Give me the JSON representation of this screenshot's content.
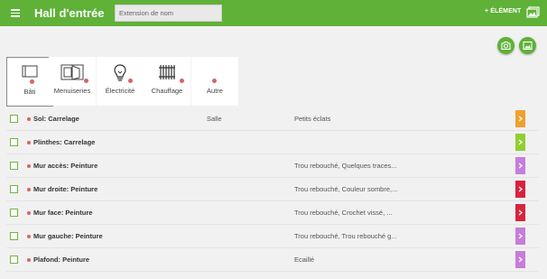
{
  "header": {
    "title": "Hall d'entrée",
    "search_placeholder": "Extension de nom",
    "add_label": "+ ÉLÉMENT"
  },
  "tabs": [
    {
      "label": "Bâti",
      "icon": "wall-icon",
      "active": true
    },
    {
      "label": "Menuiseries",
      "icon": "window-icon",
      "active": false
    },
    {
      "label": "Électricité",
      "icon": "lightbulb-icon",
      "active": false
    },
    {
      "label": "Chauffage",
      "icon": "radiator-icon",
      "active": false
    },
    {
      "label": "Autre",
      "icon": "other-icon",
      "active": false
    }
  ],
  "items": [
    {
      "title": "Sol:  Carrelage",
      "location": "Salle",
      "desc": "Petits éclats",
      "status_color": "#f0a12e"
    },
    {
      "title": "Plinthes:  Carrelage",
      "location": "",
      "desc": "",
      "status_color": "#8fcf33"
    },
    {
      "title": "Mur accès:  Peinture",
      "location": "",
      "desc": "Trou rebouché, Quelques traces...",
      "status_color": "#c77ddb"
    },
    {
      "title": "Mur droite:  Peinture",
      "location": "",
      "desc": "Trou rebouché, Couleur sombre,...",
      "status_color": "#d8233d"
    },
    {
      "title": "Mur face:  Peinture",
      "location": "",
      "desc": "Trou rebouché, Crochet vissé, ...",
      "status_color": "#d8233d"
    },
    {
      "title": "Mur gauche:  Peinture",
      "location": "",
      "desc": "Trou rebouché, Trou rebouché g...",
      "status_color": "#c77ddb"
    },
    {
      "title": "Plafond:  Peinture",
      "location": "",
      "desc": "Ecaillé",
      "status_color": "#c77ddb"
    }
  ],
  "colors": {
    "brand": "#5fb137",
    "dot": "#d9645f"
  }
}
